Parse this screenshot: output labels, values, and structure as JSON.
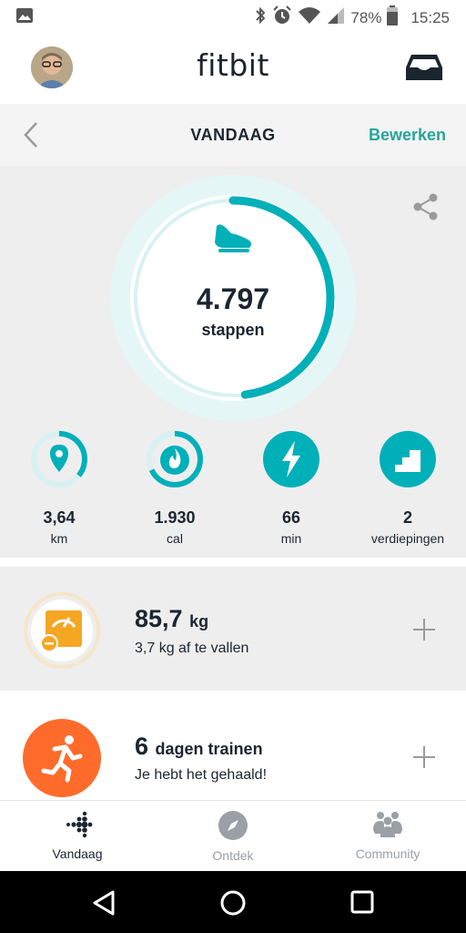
{
  "status_bar": {
    "battery": "78%",
    "time": "15:25",
    "icons": [
      "image-icon",
      "bluetooth-icon",
      "alarm-icon",
      "wifi-icon",
      "signal-icon",
      "battery-icon"
    ]
  },
  "header": {
    "title": "fitbit",
    "avatar": "avatar",
    "inbox_icon": "inbox-icon"
  },
  "subheader": {
    "back_icon": "chevron-left-icon",
    "title": "VANDAAG",
    "edit_label": "Bewerken"
  },
  "steps": {
    "value": "4.797",
    "label": "stappen",
    "progress": 0.48,
    "icon": "shoe-icon"
  },
  "share_icon": "share-icon",
  "mini_stats": [
    {
      "value": "3,64",
      "unit": "km",
      "icon": "location-pin-icon",
      "progress": 0.36,
      "complete": false
    },
    {
      "value": "1.930",
      "unit": "cal",
      "icon": "flame-icon",
      "progress": 0.68,
      "complete": false
    },
    {
      "value": "66",
      "unit": "min",
      "icon": "lightning-icon",
      "progress": 1.0,
      "complete": true
    },
    {
      "value": "2",
      "unit": "verdiepingen",
      "icon": "stairs-icon",
      "progress": 1.0,
      "complete": true
    }
  ],
  "weight_card": {
    "value": "85,7",
    "unit": "kg",
    "subtitle": "3,7 kg af te vallen",
    "icon": "scale-icon"
  },
  "exercise_card": {
    "value": "6",
    "unit": "dagen trainen",
    "subtitle": "Je hebt het gehaald!",
    "icon": "running-person-icon"
  },
  "bottom_nav": [
    {
      "label": "Vandaag",
      "icon": "fitbit-dots-icon",
      "active": true
    },
    {
      "label": "Ontdek",
      "icon": "compass-icon",
      "active": false
    },
    {
      "label": "Community",
      "icon": "community-icon",
      "active": false
    }
  ],
  "colors": {
    "accent": "#26a69a",
    "ring": "#00b0b9",
    "ring_track": "#d8f1f2",
    "weight_accent": "#f5a623",
    "exercise_accent": "#ff6b2b",
    "nav_active": "#1b2530",
    "nav_inactive": "#9aa0a6"
  }
}
